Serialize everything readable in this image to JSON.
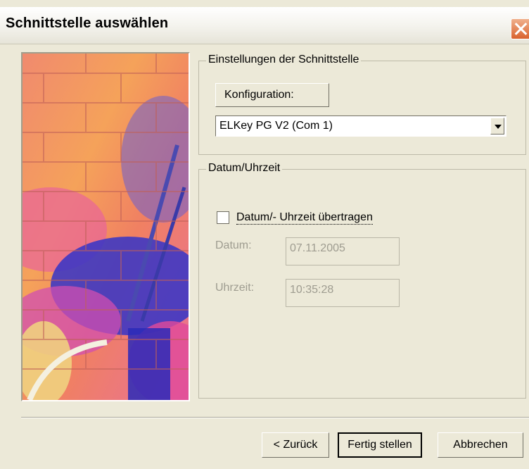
{
  "window": {
    "title": "Schnittstelle auswählen"
  },
  "settings_group": {
    "legend": "Einstellungen der Schnittstelle",
    "config_button": "Konfiguration:",
    "interface_value": "ELKey PG V2 (Com 1)"
  },
  "datetime_group": {
    "legend": "Datum/Uhrzeit",
    "transfer_label": "Datum/- Uhrzeit übertragen",
    "transfer_checked": false,
    "date_label": "Datum:",
    "date_value": "07.11.2005",
    "time_label": "Uhrzeit:",
    "time_value": "10:35:28"
  },
  "buttons": {
    "back": "< Zurück",
    "finish": "Fertig stellen",
    "cancel": "Abbrechen"
  },
  "icons": {
    "close": "close-icon",
    "dropdown": "chevron-down-icon"
  },
  "colors": {
    "dialog_bg": "#ece9d8",
    "close_button": "#d9622e"
  }
}
